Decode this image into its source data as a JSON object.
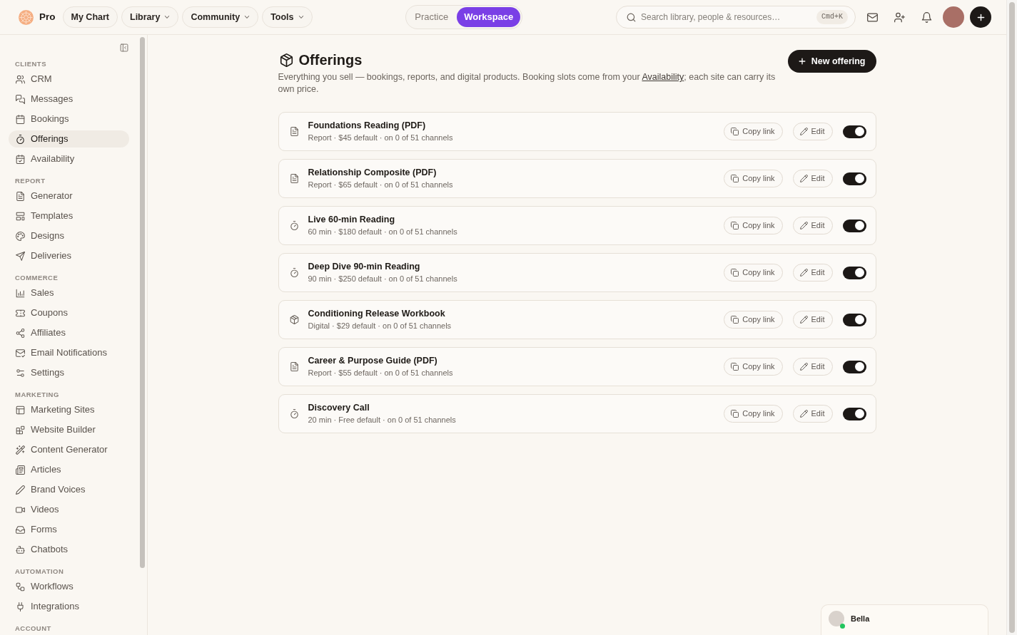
{
  "topbar": {
    "brand": "Pro",
    "nav": [
      {
        "label": "My Chart",
        "dropdown": false
      },
      {
        "label": "Library",
        "dropdown": true
      },
      {
        "label": "Community",
        "dropdown": true
      },
      {
        "label": "Tools",
        "dropdown": true
      }
    ],
    "modes": [
      {
        "label": "Practice",
        "selected": false
      },
      {
        "label": "Workspace",
        "selected": true
      }
    ],
    "search": {
      "placeholder": "Search library, people & resources…",
      "shortcut": "Cmd+K"
    }
  },
  "sidebar": {
    "sections": [
      {
        "heading": "CLIENTS",
        "items": [
          {
            "label": "CRM",
            "selected": false
          },
          {
            "label": "Messages",
            "selected": false
          },
          {
            "label": "Bookings",
            "selected": false
          },
          {
            "label": "Offerings",
            "selected": true
          },
          {
            "label": "Availability",
            "selected": false
          }
        ]
      },
      {
        "heading": "REPORT",
        "items": [
          {
            "label": "Generator",
            "selected": false
          },
          {
            "label": "Templates",
            "selected": false
          },
          {
            "label": "Designs",
            "selected": false
          },
          {
            "label": "Deliveries",
            "selected": false
          }
        ]
      },
      {
        "heading": "COMMERCE",
        "items": [
          {
            "label": "Sales",
            "selected": false
          },
          {
            "label": "Coupons",
            "selected": false
          },
          {
            "label": "Affiliates",
            "selected": false
          },
          {
            "label": "Email Notifications",
            "selected": false
          },
          {
            "label": "Settings",
            "selected": false
          }
        ]
      },
      {
        "heading": "MARKETING",
        "items": [
          {
            "label": "Marketing Sites",
            "selected": false
          },
          {
            "label": "Website Builder",
            "selected": false
          },
          {
            "label": "Content Generator",
            "selected": false
          },
          {
            "label": "Articles",
            "selected": false
          },
          {
            "label": "Brand Voices",
            "selected": false
          },
          {
            "label": "Videos",
            "selected": false
          },
          {
            "label": "Forms",
            "selected": false
          },
          {
            "label": "Chatbots",
            "selected": false
          }
        ]
      },
      {
        "heading": "AUTOMATION",
        "items": [
          {
            "label": "Workflows",
            "selected": false
          },
          {
            "label": "Integrations",
            "selected": false
          }
        ]
      },
      {
        "heading": "ACCOUNT"
      }
    ]
  },
  "page": {
    "title": "Offerings",
    "description": {
      "text_before": "Everything you sell — bookings, reports, and digital products. Booking slots come from your ",
      "link": "Availability",
      "text_after": "; each site can carry its own price."
    },
    "primary_button": "New offering"
  },
  "offerings": [
    {
      "kind": "report",
      "title": "Foundations Reading (PDF)",
      "details": "Report · $45 default · on 0 of 51 channels",
      "buttons": [
        {
          "kind": "copy",
          "label": "Copy link"
        },
        {
          "kind": "edit",
          "label": "Edit"
        }
      ],
      "on": true
    },
    {
      "kind": "report",
      "title": "Relationship Composite (PDF)",
      "details": "Report · $65 default · on 0 of 51 channels",
      "buttons": [
        {
          "kind": "copy",
          "label": "Copy link"
        },
        {
          "kind": "edit",
          "label": "Edit"
        }
      ],
      "on": true
    },
    {
      "kind": "session",
      "title": "Live 60-min Reading",
      "details": "60 min · $180 default · on 0 of 51 channels",
      "buttons": [
        {
          "kind": "copy",
          "label": "Copy link"
        },
        {
          "kind": "edit",
          "label": "Edit"
        }
      ],
      "on": true
    },
    {
      "kind": "session",
      "title": "Deep Dive 90-min Reading",
      "details": "90 min · $250 default · on 0 of 51 channels",
      "buttons": [
        {
          "kind": "copy",
          "label": "Copy link"
        },
        {
          "kind": "edit",
          "label": "Edit"
        }
      ],
      "on": true
    },
    {
      "kind": "digital",
      "title": "Conditioning Release Workbook",
      "details": "Digital · $29 default · on 0 of 51 channels",
      "buttons": [
        {
          "kind": "copy",
          "label": "Copy link"
        },
        {
          "kind": "edit",
          "label": "Edit"
        }
      ],
      "on": true
    },
    {
      "kind": "report",
      "title": "Career & Purpose Guide (PDF)",
      "details": "Report · $55 default · on 0 of 51 channels",
      "buttons": [
        {
          "kind": "copy",
          "label": "Copy link"
        },
        {
          "kind": "edit",
          "label": "Edit"
        }
      ],
      "on": true
    },
    {
      "kind": "session",
      "title": "Discovery Call",
      "details": "20 min · Free default · on 0 of 51 channels",
      "buttons": [
        {
          "kind": "copy",
          "label": "Copy link"
        },
        {
          "kind": "edit",
          "label": "Edit"
        }
      ],
      "on": true
    }
  ],
  "chat": {
    "name": "Bella",
    "online": true
  }
}
